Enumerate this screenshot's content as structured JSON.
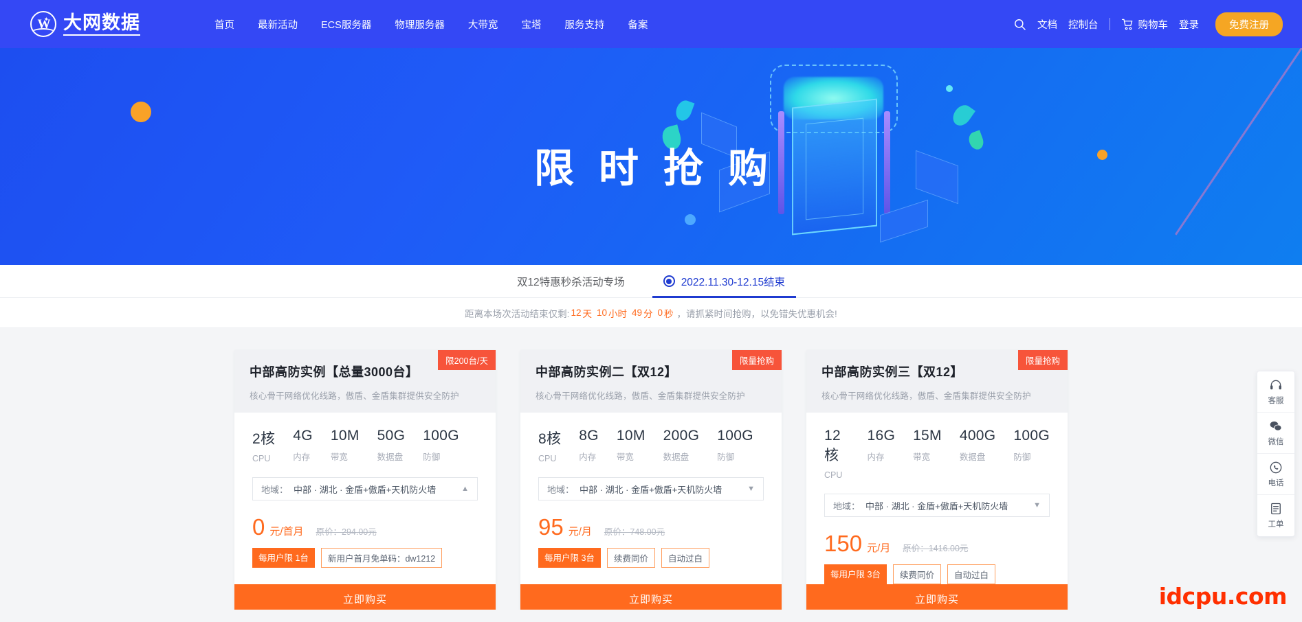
{
  "header": {
    "logo_text": "大网数据",
    "logo_icon": "globe-w-icon",
    "nav": [
      {
        "label": "首页"
      },
      {
        "label": "最新活动"
      },
      {
        "label": "ECS服务器"
      },
      {
        "label": "物理服务器"
      },
      {
        "label": "大带宽"
      },
      {
        "label": "宝塔"
      },
      {
        "label": "服务支持"
      },
      {
        "label": "备案"
      }
    ],
    "search_icon": "search-icon",
    "docs_label": "文档",
    "console_label": "控制台",
    "cart_icon": "cart-icon",
    "cart_label": "购物车",
    "login_label": "登录",
    "register_label": "免费注册",
    "brand_color": "#3448f5",
    "register_color": "#f5a623"
  },
  "hero": {
    "title": "限时抢购"
  },
  "tabs": [
    {
      "label": "双12特惠秒杀活动专场",
      "active": false,
      "icon": ""
    },
    {
      "label": "2022.11.30-12.15结束",
      "active": true,
      "icon": "radio-target-icon"
    }
  ],
  "countdown": {
    "prefix": "距离本场次活动结束仅剩:",
    "days": "12",
    "days_unit": "天",
    "hours": "10",
    "hours_unit": "小时",
    "minutes": "49",
    "minutes_unit": "分",
    "seconds": "0",
    "seconds_unit": "秒",
    "suffix": "，请抓紧时间抢购，以免错失优惠机会!",
    "accent_color": "#ff6a1e"
  },
  "cards": [
    {
      "title": "中部高防实例【总量3000台】",
      "badge": "限200台/天",
      "subtitle": "核心骨干网络优化线路，傲盾、金盾集群提供安全防护",
      "specs": [
        {
          "value": "2核",
          "label": "CPU"
        },
        {
          "value": "4G",
          "label": "内存"
        },
        {
          "value": "10M",
          "label": "带宽"
        },
        {
          "value": "50G",
          "label": "数据盘"
        },
        {
          "value": "100G",
          "label": "防御"
        }
      ],
      "region_label": "地域：",
      "region_value": "中部 · 湖北 · 金盾+傲盾+天机防火墙",
      "region_chevron": "chevron-up-icon",
      "price": "0",
      "price_unit": "元/首月",
      "original_price": "原价：294.00元",
      "tags": [
        {
          "text": "每用户限 1台",
          "style": "solid"
        },
        {
          "text": "新用户首月免单码：dw1212",
          "style": "outline"
        }
      ],
      "buy_label": "立即购买"
    },
    {
      "title": "中部高防实例二【双12】",
      "badge": "限量抢购",
      "subtitle": "核心骨干网络优化线路，傲盾、金盾集群提供安全防护",
      "specs": [
        {
          "value": "8核",
          "label": "CPU"
        },
        {
          "value": "8G",
          "label": "内存"
        },
        {
          "value": "10M",
          "label": "带宽"
        },
        {
          "value": "200G",
          "label": "数据盘"
        },
        {
          "value": "100G",
          "label": "防御"
        }
      ],
      "region_label": "地域：",
      "region_value": "中部 · 湖北 · 金盾+傲盾+天机防火墙",
      "region_chevron": "chevron-down-icon",
      "price": "95",
      "price_unit": "元/月",
      "original_price": "原价：748.00元",
      "tags": [
        {
          "text": "每用户限 3台",
          "style": "solid"
        },
        {
          "text": "续费同价",
          "style": "outline"
        },
        {
          "text": "自动过白",
          "style": "outline"
        }
      ],
      "buy_label": "立即购买"
    },
    {
      "title": "中部高防实例三【双12】",
      "badge": "限量抢购",
      "subtitle": "核心骨干网络优化线路，傲盾、金盾集群提供安全防护",
      "specs": [
        {
          "value": "12核",
          "label": "CPU"
        },
        {
          "value": "16G",
          "label": "内存"
        },
        {
          "value": "15M",
          "label": "带宽"
        },
        {
          "value": "400G",
          "label": "数据盘"
        },
        {
          "value": "100G",
          "label": "防御"
        }
      ],
      "region_label": "地域：",
      "region_value": "中部 · 湖北 · 金盾+傲盾+天机防火墙",
      "region_chevron": "chevron-down-icon",
      "price": "150",
      "price_unit": "元/月",
      "original_price": "原价：1416.00元",
      "tags": [
        {
          "text": "每用户限 3台",
          "style": "solid"
        },
        {
          "text": "续费同价",
          "style": "outline"
        },
        {
          "text": "自动过白",
          "style": "outline"
        }
      ],
      "buy_label": "立即购买"
    }
  ],
  "float_bar": [
    {
      "label": "客服",
      "icon": "headset-icon"
    },
    {
      "label": "微信",
      "icon": "wechat-icon"
    },
    {
      "label": "电话",
      "icon": "phone-icon"
    },
    {
      "label": "工单",
      "icon": "ticket-icon"
    }
  ],
  "watermark": "idcpu.com"
}
